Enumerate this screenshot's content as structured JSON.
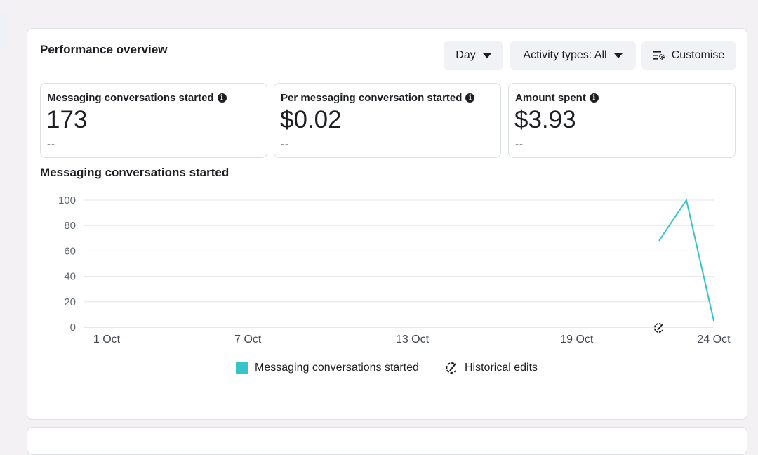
{
  "header": {
    "title": "Performance overview",
    "period_label": "Day",
    "activity_label": "Activity types: All",
    "customise_label": "Customise"
  },
  "metrics": [
    {
      "label": "Messaging conversations started",
      "value": "173",
      "comparison": "--"
    },
    {
      "label": "Per messaging conversation started",
      "value": "$0.02",
      "comparison": "--"
    },
    {
      "label": "Amount spent",
      "value": "$3.93",
      "comparison": "--"
    }
  ],
  "chart_title": "Messaging conversations started",
  "legend": {
    "series_label": "Messaging conversations started",
    "edits_label": "Historical edits"
  },
  "colors": {
    "series": "#33c5c7",
    "grid": "#e4e6eb"
  },
  "chart_data": {
    "type": "line",
    "title": "Messaging conversations started",
    "ylim": [
      0,
      100
    ],
    "yticks": [
      0,
      20,
      40,
      60,
      80,
      100
    ],
    "xlim": [
      1,
      24
    ],
    "xticks": [
      {
        "label": "1 Oct",
        "day": 1
      },
      {
        "label": "7 Oct",
        "day": 7
      },
      {
        "label": "13 Oct",
        "day": 13
      },
      {
        "label": "19 Oct",
        "day": 19
      },
      {
        "label": "24 Oct",
        "day": 24
      }
    ],
    "series": [
      {
        "name": "Messaging conversations started",
        "x": [
          "22 Oct",
          "23 Oct",
          "24 Oct"
        ],
        "days": [
          22,
          23,
          24
        ],
        "y": [
          68,
          100,
          5
        ]
      }
    ],
    "historical_edit_markers": [
      "22 Oct"
    ]
  }
}
